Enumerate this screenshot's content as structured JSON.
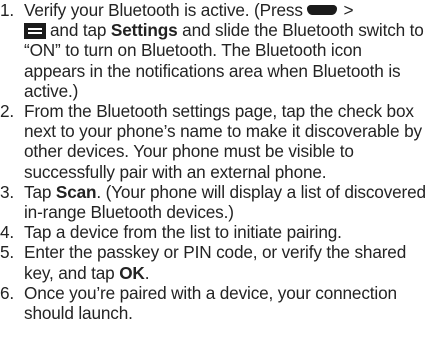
{
  "steps": [
    {
      "num": "1.",
      "part_a": "Verify your Bluetooth is active. (Press",
      "home_key_icon": "home-key-icon",
      "part_b": " >",
      "menu_key_icon": "menu-key-icon",
      "part_c": "and tap ",
      "bold_1": "Settings",
      "part_d": " and slide the Bluetooth switch to “ON” to turn on Bluetooth. The Bluetooth icon appears in the notifications area when Bluetooth is active.)"
    },
    {
      "num": "2.",
      "text": "From the Bluetooth settings page, tap the check box next to your phone’s name to make it discoverable by other devices. Your phone must be visible to successfully pair with an external phone."
    },
    {
      "num": "3.",
      "part_a": "Tap ",
      "bold_1": "Scan",
      "part_b": ". (Your phone will display a list of discovered in-range Bluetooth devices.)"
    },
    {
      "num": "4.",
      "text": "Tap a device from the list to initiate pairing."
    },
    {
      "num": "5.",
      "part_a": "Enter the passkey or PIN code, or verify the shared key, and tap ",
      "bold_1": "OK",
      "part_b": "."
    },
    {
      "num": "6.",
      "text": "Once you’re paired with a device, your connection should launch."
    }
  ]
}
